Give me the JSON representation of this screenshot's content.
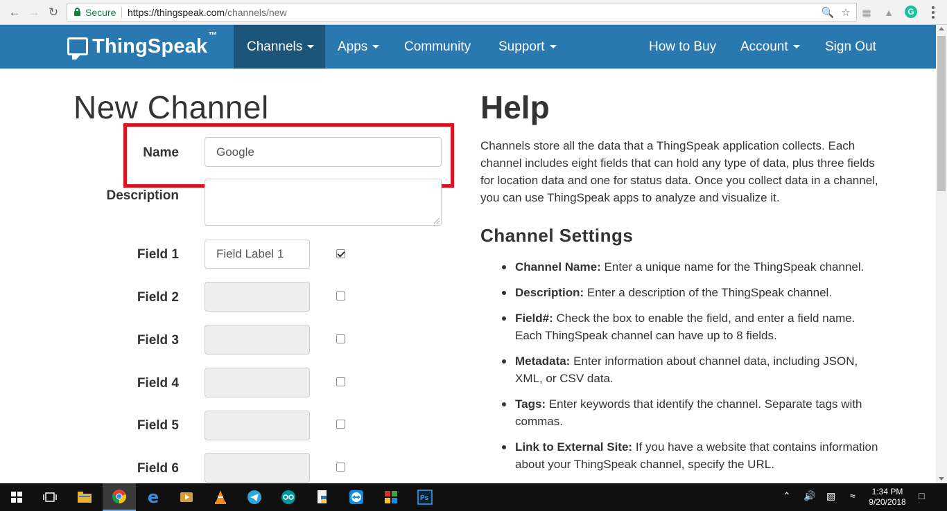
{
  "browser": {
    "secure_label": "Secure",
    "url_host": "https://thingspeak.com",
    "url_path": "/channels/new"
  },
  "navbar": {
    "brand": "ThingSpeak",
    "brand_tm": "™",
    "items": [
      "Channels",
      "Apps",
      "Community",
      "Support",
      "How to Buy",
      "Account",
      "Sign Out"
    ]
  },
  "form": {
    "title": "New Channel",
    "name_label": "Name",
    "name_value": "Google",
    "description_label": "Description",
    "description_value": "",
    "fields": [
      {
        "label": "Field 1",
        "value": "Field Label 1",
        "checked": true
      },
      {
        "label": "Field 2",
        "value": "",
        "checked": false
      },
      {
        "label": "Field 3",
        "value": "",
        "checked": false
      },
      {
        "label": "Field 4",
        "value": "",
        "checked": false
      },
      {
        "label": "Field 5",
        "value": "",
        "checked": false
      },
      {
        "label": "Field 6",
        "value": "",
        "checked": false
      }
    ]
  },
  "help": {
    "title": "Help",
    "intro": "Channels store all the data that a ThingSpeak application collects. Each channel includes eight fields that can hold any type of data, plus three fields for location data and one for status data. Once you collect data in a channel, you can use ThingSpeak apps to analyze and visualize it.",
    "settings_title": "Channel Settings",
    "items": [
      {
        "term": "Channel Name:",
        "text": " Enter a unique name for the ThingSpeak channel."
      },
      {
        "term": "Description:",
        "text": " Enter a description of the ThingSpeak channel."
      },
      {
        "term": "Field#:",
        "text": " Check the box to enable the field, and enter a field name. Each ThingSpeak channel can have up to 8 fields."
      },
      {
        "term": "Metadata:",
        "text": " Enter information about channel data, including JSON, XML, or CSV data."
      },
      {
        "term": "Tags:",
        "text": " Enter keywords that identify the channel. Separate tags with commas."
      },
      {
        "term": "Link to External Site:",
        "text": " If you have a website that contains information about your ThingSpeak channel, specify the URL."
      }
    ]
  },
  "taskbar": {
    "time": "1:34 PM",
    "date": "9/20/2018"
  },
  "colors": {
    "navbar": "#2a78b0",
    "navbar_active": "#1d5479",
    "highlight_box": "#e0121b"
  }
}
